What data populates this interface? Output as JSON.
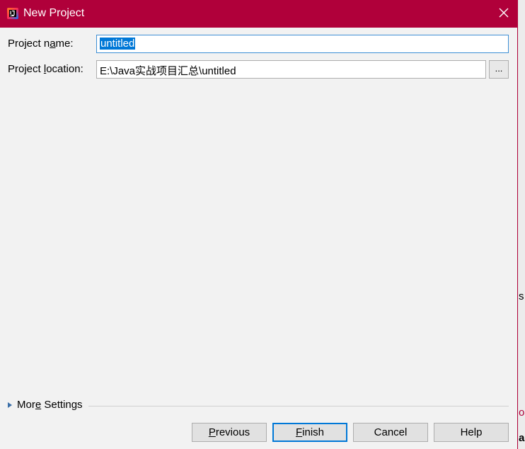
{
  "window": {
    "title": "New Project",
    "accent_color": "#b0003a",
    "icon": "intellij-idea-icon"
  },
  "form": {
    "project_name": {
      "label_before": "Project n",
      "label_mnemonic": "a",
      "label_after": "me:",
      "value": "untitled"
    },
    "project_location": {
      "label_before": "Project ",
      "label_mnemonic": "l",
      "label_after": "ocation:",
      "value": "E:\\Java实战项目汇总\\untitled",
      "browse_label": "..."
    }
  },
  "more_settings": {
    "label_before": "Mor",
    "label_mnemonic": "e",
    "label_after": " Settings"
  },
  "buttons": {
    "previous": {
      "mnemonic": "P",
      "rest": "revious"
    },
    "finish": {
      "mnemonic": "F",
      "rest": "inish"
    },
    "cancel": {
      "label": "Cancel"
    },
    "help": {
      "label": "Help"
    }
  },
  "background_fragments": [
    "s .",
    "or",
    "ar"
  ]
}
